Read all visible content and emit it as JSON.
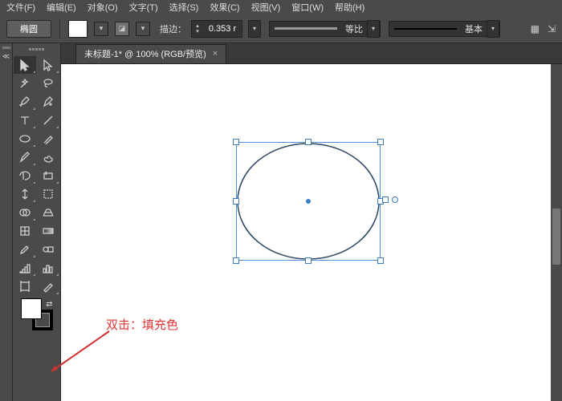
{
  "menu": [
    "文件(F)",
    "编辑(E)",
    "对象(O)",
    "文字(T)",
    "选择(S)",
    "效果(C)",
    "视图(V)",
    "窗口(W)",
    "帮助(H)"
  ],
  "toolLabel": "椭圆",
  "strokeLabel": "描边：",
  "strokeValue": "0.353 r",
  "profile1": {
    "label": "等比"
  },
  "profile2": {
    "label": "基本"
  },
  "tab": {
    "title": "未标题-1* @ 100% (RGB/预览)"
  },
  "annotation": "双击：填充色",
  "colors": {
    "fill": "#ffffff",
    "selection": "#3a7cc0",
    "ellipseStroke": "#2b4560",
    "annotation": "#d03030"
  },
  "chart_data": null,
  "tools": [
    [
      "selection",
      "direct-selection"
    ],
    [
      "magic-wand",
      "lasso"
    ],
    [
      "pen",
      "curvature"
    ],
    [
      "type",
      "line-segment"
    ],
    [
      "ellipse",
      "paintbrush"
    ],
    [
      "pencil",
      "blob-brush"
    ],
    [
      "eraser",
      "rotate"
    ],
    [
      "scale",
      "free-transform"
    ],
    [
      "shape-builder",
      "perspective"
    ],
    [
      "mesh",
      "gradient"
    ],
    [
      "eyedropper",
      "blend"
    ],
    [
      "symbol-sprayer",
      "column-graph"
    ],
    [
      "artboard",
      "slice"
    ]
  ]
}
